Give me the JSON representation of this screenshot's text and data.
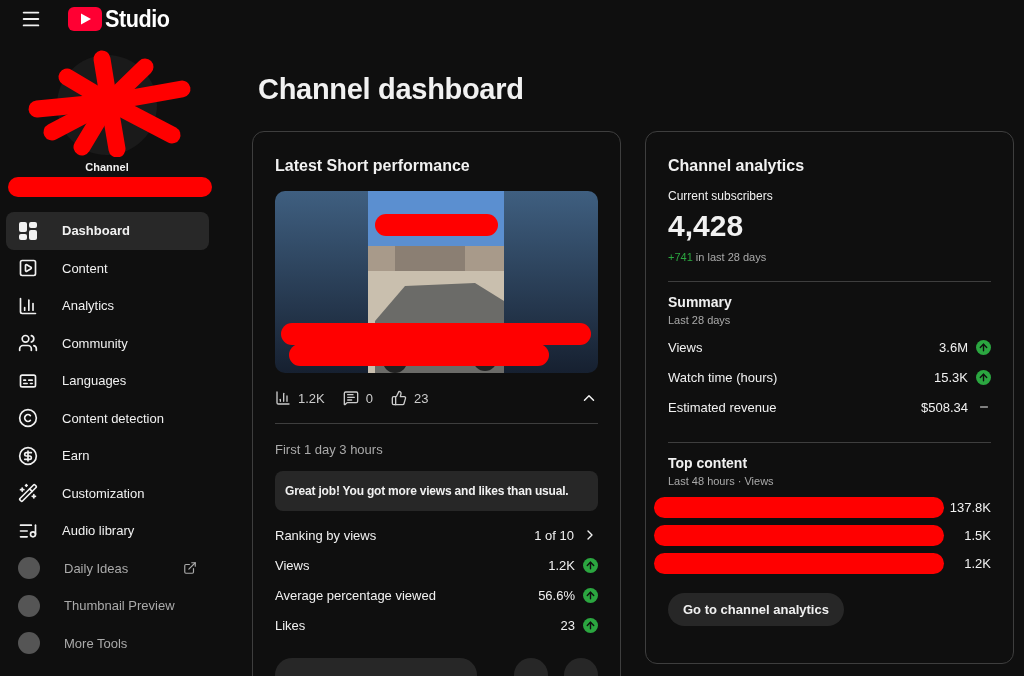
{
  "app": {
    "logo_text": "Studio"
  },
  "channel": {
    "label": "Channel"
  },
  "sidebar": {
    "items": [
      {
        "label": "Dashboard",
        "selected": true,
        "kind": "page"
      },
      {
        "label": "Content",
        "selected": false,
        "kind": "page"
      },
      {
        "label": "Analytics",
        "selected": false,
        "kind": "page"
      },
      {
        "label": "Community",
        "selected": false,
        "kind": "page"
      },
      {
        "label": "Languages",
        "selected": false,
        "kind": "page"
      },
      {
        "label": "Content detection",
        "selected": false,
        "kind": "page"
      },
      {
        "label": "Earn",
        "selected": false,
        "kind": "page"
      },
      {
        "label": "Customization",
        "selected": false,
        "kind": "page"
      },
      {
        "label": "Audio library",
        "selected": false,
        "kind": "page"
      },
      {
        "label": "Daily Ideas",
        "selected": false,
        "kind": "extension",
        "external": true
      },
      {
        "label": "Thumbnail Preview",
        "selected": false,
        "kind": "extension",
        "external": false
      },
      {
        "label": "More Tools",
        "selected": false,
        "kind": "extension",
        "external": false
      }
    ]
  },
  "page": {
    "title": "Channel dashboard"
  },
  "latest_short": {
    "title": "Latest Short performance",
    "stats": [
      {
        "value": "1.2K"
      },
      {
        "value": "0"
      },
      {
        "value": "23"
      }
    ],
    "expanded": true,
    "period": "First 1 day 3 hours",
    "message": "Great job! You got more views and likes than usual.",
    "ranking": {
      "label": "Ranking by views",
      "value": "1 of 10"
    },
    "metrics": [
      {
        "label": "Views",
        "value": "1.2K",
        "increased": true
      },
      {
        "label": "Average percentage viewed",
        "value": "56.6%",
        "increased": true
      },
      {
        "label": "Likes",
        "value": "23",
        "increased": true
      }
    ]
  },
  "channel_analytics": {
    "title": "Channel analytics",
    "subscribers_label": "Current subscribers",
    "subscribers": "4,428",
    "delta": "+741",
    "delta_suffix": "in last 28 days",
    "summary": {
      "title": "Summary",
      "subtitle": "Last 28 days",
      "rows": [
        {
          "label": "Views",
          "value": "3.6M",
          "increased": true
        },
        {
          "label": "Watch time (hours)",
          "value": "15.3K",
          "increased": true
        },
        {
          "label": "Estimated revenue",
          "value": "$508.34",
          "increased": false
        }
      ]
    },
    "top_content": {
      "title": "Top content",
      "subtitle": "Last 48 hours · Views",
      "rows": [
        {
          "value": "137.8K"
        },
        {
          "value": "1.5K"
        },
        {
          "value": "1.2K"
        }
      ]
    },
    "button": "Go to channel analytics"
  }
}
